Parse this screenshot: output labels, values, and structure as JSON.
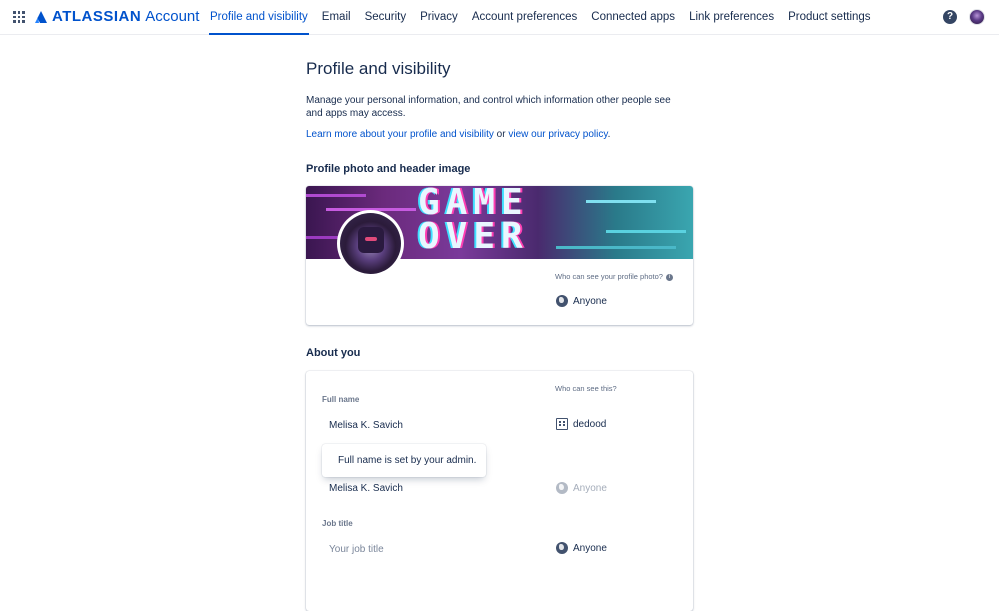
{
  "brand": {
    "name": "ATLASSIAN",
    "product": "Account",
    "color": "#0052cc"
  },
  "nav": {
    "items": [
      {
        "label": "Profile and visibility",
        "active": true
      },
      {
        "label": "Email",
        "active": false
      },
      {
        "label": "Security",
        "active": false
      },
      {
        "label": "Privacy",
        "active": false
      },
      {
        "label": "Account preferences",
        "active": false
      },
      {
        "label": "Connected apps",
        "active": false
      },
      {
        "label": "Link preferences",
        "active": false
      },
      {
        "label": "Product settings",
        "active": false
      }
    ],
    "help_icon": "question-circle-icon",
    "apps_icon": "app-switcher-icon"
  },
  "page": {
    "title": "Profile and visibility",
    "intro": "Manage your personal information, and control which information other people see and apps may access.",
    "learn_more_link": "Learn more about your profile and visibility",
    "or_text": " or ",
    "privacy_link": "view our privacy policy",
    "period": "."
  },
  "photo_section": {
    "heading": "Profile photo and header image",
    "header_text_line1": "GAME",
    "header_text_line2": "OVER",
    "visibility_question": "Who can see your profile photo?",
    "visibility_value": "Anyone"
  },
  "about_section": {
    "heading": "About you",
    "who_can_see": "Who can see this?",
    "fields": {
      "full_name": {
        "label": "Full name",
        "value": "Melisa K. Savich",
        "visibility": "dedood"
      },
      "public_name": {
        "value": "Melisa K. Savich",
        "visibility": "Anyone"
      },
      "job_title": {
        "label": "Job title",
        "placeholder": "Your job title",
        "visibility": "Anyone"
      }
    },
    "tooltip": "Full name is set by your admin."
  }
}
